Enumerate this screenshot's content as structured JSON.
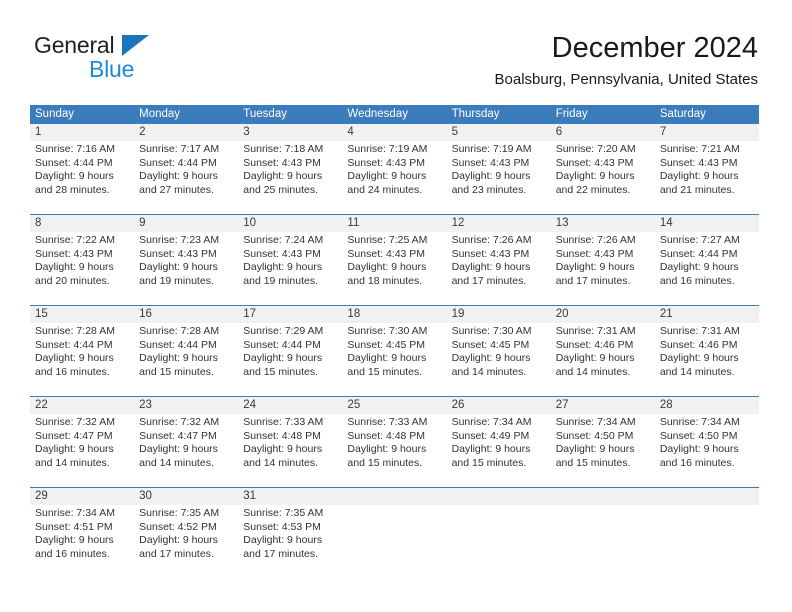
{
  "brand": {
    "name_dark": "General",
    "name_blue": "Blue",
    "accent_color": "#1b75bb",
    "blue_text_color": "#1b8ad8"
  },
  "header": {
    "title": "December 2024",
    "subtitle": "Boalsburg, Pennsylvania, United States",
    "header_bg_color": "#3b7cbd",
    "daynum_strip_color": "#f1f1f1"
  },
  "weekdays": [
    "Sunday",
    "Monday",
    "Tuesday",
    "Wednesday",
    "Thursday",
    "Friday",
    "Saturday"
  ],
  "weeks": [
    [
      {
        "day": "1",
        "info": "Sunrise: 7:16 AM\nSunset: 4:44 PM\nDaylight: 9 hours\nand 28 minutes."
      },
      {
        "day": "2",
        "info": "Sunrise: 7:17 AM\nSunset: 4:44 PM\nDaylight: 9 hours\nand 27 minutes."
      },
      {
        "day": "3",
        "info": "Sunrise: 7:18 AM\nSunset: 4:43 PM\nDaylight: 9 hours\nand 25 minutes."
      },
      {
        "day": "4",
        "info": "Sunrise: 7:19 AM\nSunset: 4:43 PM\nDaylight: 9 hours\nand 24 minutes."
      },
      {
        "day": "5",
        "info": "Sunrise: 7:19 AM\nSunset: 4:43 PM\nDaylight: 9 hours\nand 23 minutes."
      },
      {
        "day": "6",
        "info": "Sunrise: 7:20 AM\nSunset: 4:43 PM\nDaylight: 9 hours\nand 22 minutes."
      },
      {
        "day": "7",
        "info": "Sunrise: 7:21 AM\nSunset: 4:43 PM\nDaylight: 9 hours\nand 21 minutes."
      }
    ],
    [
      {
        "day": "8",
        "info": "Sunrise: 7:22 AM\nSunset: 4:43 PM\nDaylight: 9 hours\nand 20 minutes."
      },
      {
        "day": "9",
        "info": "Sunrise: 7:23 AM\nSunset: 4:43 PM\nDaylight: 9 hours\nand 19 minutes."
      },
      {
        "day": "10",
        "info": "Sunrise: 7:24 AM\nSunset: 4:43 PM\nDaylight: 9 hours\nand 19 minutes."
      },
      {
        "day": "11",
        "info": "Sunrise: 7:25 AM\nSunset: 4:43 PM\nDaylight: 9 hours\nand 18 minutes."
      },
      {
        "day": "12",
        "info": "Sunrise: 7:26 AM\nSunset: 4:43 PM\nDaylight: 9 hours\nand 17 minutes."
      },
      {
        "day": "13",
        "info": "Sunrise: 7:26 AM\nSunset: 4:43 PM\nDaylight: 9 hours\nand 17 minutes."
      },
      {
        "day": "14",
        "info": "Sunrise: 7:27 AM\nSunset: 4:44 PM\nDaylight: 9 hours\nand 16 minutes."
      }
    ],
    [
      {
        "day": "15",
        "info": "Sunrise: 7:28 AM\nSunset: 4:44 PM\nDaylight: 9 hours\nand 16 minutes."
      },
      {
        "day": "16",
        "info": "Sunrise: 7:28 AM\nSunset: 4:44 PM\nDaylight: 9 hours\nand 15 minutes."
      },
      {
        "day": "17",
        "info": "Sunrise: 7:29 AM\nSunset: 4:44 PM\nDaylight: 9 hours\nand 15 minutes."
      },
      {
        "day": "18",
        "info": "Sunrise: 7:30 AM\nSunset: 4:45 PM\nDaylight: 9 hours\nand 15 minutes."
      },
      {
        "day": "19",
        "info": "Sunrise: 7:30 AM\nSunset: 4:45 PM\nDaylight: 9 hours\nand 14 minutes."
      },
      {
        "day": "20",
        "info": "Sunrise: 7:31 AM\nSunset: 4:46 PM\nDaylight: 9 hours\nand 14 minutes."
      },
      {
        "day": "21",
        "info": "Sunrise: 7:31 AM\nSunset: 4:46 PM\nDaylight: 9 hours\nand 14 minutes."
      }
    ],
    [
      {
        "day": "22",
        "info": "Sunrise: 7:32 AM\nSunset: 4:47 PM\nDaylight: 9 hours\nand 14 minutes."
      },
      {
        "day": "23",
        "info": "Sunrise: 7:32 AM\nSunset: 4:47 PM\nDaylight: 9 hours\nand 14 minutes."
      },
      {
        "day": "24",
        "info": "Sunrise: 7:33 AM\nSunset: 4:48 PM\nDaylight: 9 hours\nand 14 minutes."
      },
      {
        "day": "25",
        "info": "Sunrise: 7:33 AM\nSunset: 4:48 PM\nDaylight: 9 hours\nand 15 minutes."
      },
      {
        "day": "26",
        "info": "Sunrise: 7:34 AM\nSunset: 4:49 PM\nDaylight: 9 hours\nand 15 minutes."
      },
      {
        "day": "27",
        "info": "Sunrise: 7:34 AM\nSunset: 4:50 PM\nDaylight: 9 hours\nand 15 minutes."
      },
      {
        "day": "28",
        "info": "Sunrise: 7:34 AM\nSunset: 4:50 PM\nDaylight: 9 hours\nand 16 minutes."
      }
    ],
    [
      {
        "day": "29",
        "info": "Sunrise: 7:34 AM\nSunset: 4:51 PM\nDaylight: 9 hours\nand 16 minutes."
      },
      {
        "day": "30",
        "info": "Sunrise: 7:35 AM\nSunset: 4:52 PM\nDaylight: 9 hours\nand 17 minutes."
      },
      {
        "day": "31",
        "info": "Sunrise: 7:35 AM\nSunset: 4:53 PM\nDaylight: 9 hours\nand 17 minutes."
      },
      {
        "day": "",
        "info": ""
      },
      {
        "day": "",
        "info": ""
      },
      {
        "day": "",
        "info": ""
      },
      {
        "day": "",
        "info": ""
      }
    ]
  ]
}
